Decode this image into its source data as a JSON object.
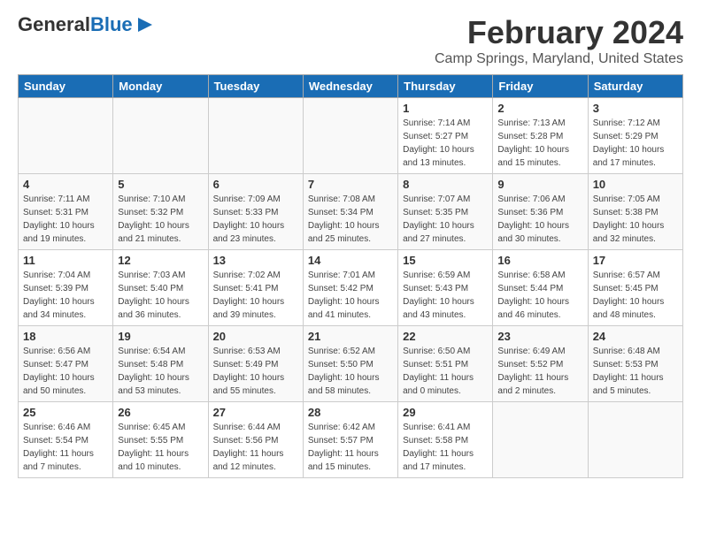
{
  "logo": {
    "line1": "General",
    "line2": "Blue"
  },
  "header": {
    "month": "February 2024",
    "location": "Camp Springs, Maryland, United States"
  },
  "weekdays": [
    "Sunday",
    "Monday",
    "Tuesday",
    "Wednesday",
    "Thursday",
    "Friday",
    "Saturday"
  ],
  "weeks": [
    [
      {
        "day": "",
        "info": ""
      },
      {
        "day": "",
        "info": ""
      },
      {
        "day": "",
        "info": ""
      },
      {
        "day": "",
        "info": ""
      },
      {
        "day": "1",
        "info": "Sunrise: 7:14 AM\nSunset: 5:27 PM\nDaylight: 10 hours\nand 13 minutes."
      },
      {
        "day": "2",
        "info": "Sunrise: 7:13 AM\nSunset: 5:28 PM\nDaylight: 10 hours\nand 15 minutes."
      },
      {
        "day": "3",
        "info": "Sunrise: 7:12 AM\nSunset: 5:29 PM\nDaylight: 10 hours\nand 17 minutes."
      }
    ],
    [
      {
        "day": "4",
        "info": "Sunrise: 7:11 AM\nSunset: 5:31 PM\nDaylight: 10 hours\nand 19 minutes."
      },
      {
        "day": "5",
        "info": "Sunrise: 7:10 AM\nSunset: 5:32 PM\nDaylight: 10 hours\nand 21 minutes."
      },
      {
        "day": "6",
        "info": "Sunrise: 7:09 AM\nSunset: 5:33 PM\nDaylight: 10 hours\nand 23 minutes."
      },
      {
        "day": "7",
        "info": "Sunrise: 7:08 AM\nSunset: 5:34 PM\nDaylight: 10 hours\nand 25 minutes."
      },
      {
        "day": "8",
        "info": "Sunrise: 7:07 AM\nSunset: 5:35 PM\nDaylight: 10 hours\nand 27 minutes."
      },
      {
        "day": "9",
        "info": "Sunrise: 7:06 AM\nSunset: 5:36 PM\nDaylight: 10 hours\nand 30 minutes."
      },
      {
        "day": "10",
        "info": "Sunrise: 7:05 AM\nSunset: 5:38 PM\nDaylight: 10 hours\nand 32 minutes."
      }
    ],
    [
      {
        "day": "11",
        "info": "Sunrise: 7:04 AM\nSunset: 5:39 PM\nDaylight: 10 hours\nand 34 minutes."
      },
      {
        "day": "12",
        "info": "Sunrise: 7:03 AM\nSunset: 5:40 PM\nDaylight: 10 hours\nand 36 minutes."
      },
      {
        "day": "13",
        "info": "Sunrise: 7:02 AM\nSunset: 5:41 PM\nDaylight: 10 hours\nand 39 minutes."
      },
      {
        "day": "14",
        "info": "Sunrise: 7:01 AM\nSunset: 5:42 PM\nDaylight: 10 hours\nand 41 minutes."
      },
      {
        "day": "15",
        "info": "Sunrise: 6:59 AM\nSunset: 5:43 PM\nDaylight: 10 hours\nand 43 minutes."
      },
      {
        "day": "16",
        "info": "Sunrise: 6:58 AM\nSunset: 5:44 PM\nDaylight: 10 hours\nand 46 minutes."
      },
      {
        "day": "17",
        "info": "Sunrise: 6:57 AM\nSunset: 5:45 PM\nDaylight: 10 hours\nand 48 minutes."
      }
    ],
    [
      {
        "day": "18",
        "info": "Sunrise: 6:56 AM\nSunset: 5:47 PM\nDaylight: 10 hours\nand 50 minutes."
      },
      {
        "day": "19",
        "info": "Sunrise: 6:54 AM\nSunset: 5:48 PM\nDaylight: 10 hours\nand 53 minutes."
      },
      {
        "day": "20",
        "info": "Sunrise: 6:53 AM\nSunset: 5:49 PM\nDaylight: 10 hours\nand 55 minutes."
      },
      {
        "day": "21",
        "info": "Sunrise: 6:52 AM\nSunset: 5:50 PM\nDaylight: 10 hours\nand 58 minutes."
      },
      {
        "day": "22",
        "info": "Sunrise: 6:50 AM\nSunset: 5:51 PM\nDaylight: 11 hours\nand 0 minutes."
      },
      {
        "day": "23",
        "info": "Sunrise: 6:49 AM\nSunset: 5:52 PM\nDaylight: 11 hours\nand 2 minutes."
      },
      {
        "day": "24",
        "info": "Sunrise: 6:48 AM\nSunset: 5:53 PM\nDaylight: 11 hours\nand 5 minutes."
      }
    ],
    [
      {
        "day": "25",
        "info": "Sunrise: 6:46 AM\nSunset: 5:54 PM\nDaylight: 11 hours\nand 7 minutes."
      },
      {
        "day": "26",
        "info": "Sunrise: 6:45 AM\nSunset: 5:55 PM\nDaylight: 11 hours\nand 10 minutes."
      },
      {
        "day": "27",
        "info": "Sunrise: 6:44 AM\nSunset: 5:56 PM\nDaylight: 11 hours\nand 12 minutes."
      },
      {
        "day": "28",
        "info": "Sunrise: 6:42 AM\nSunset: 5:57 PM\nDaylight: 11 hours\nand 15 minutes."
      },
      {
        "day": "29",
        "info": "Sunrise: 6:41 AM\nSunset: 5:58 PM\nDaylight: 11 hours\nand 17 minutes."
      },
      {
        "day": "",
        "info": ""
      },
      {
        "day": "",
        "info": ""
      }
    ]
  ]
}
